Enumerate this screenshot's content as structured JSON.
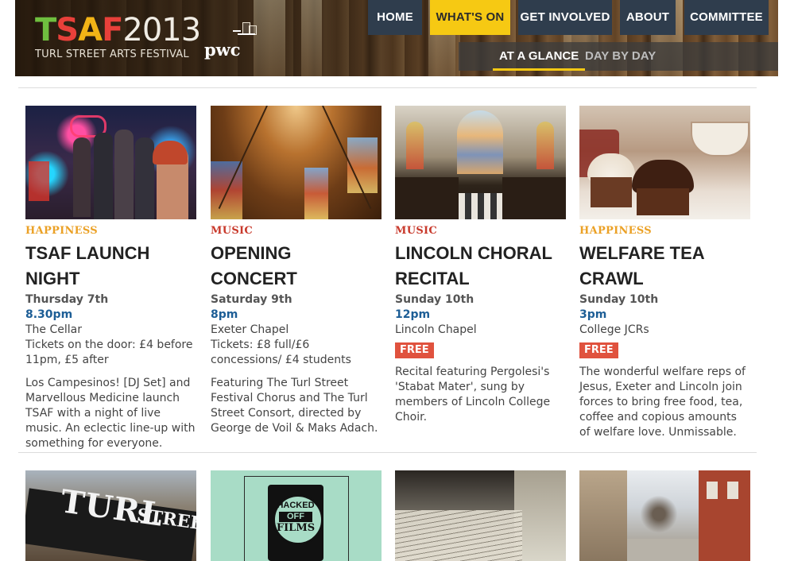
{
  "site": {
    "logo": {
      "letters": [
        "T",
        "S",
        "A",
        "F"
      ],
      "year": "2013"
    },
    "tagline": "TURL STREET ARTS FESTIVAL",
    "sponsor": "pwc"
  },
  "nav": {
    "items": [
      {
        "label": "HOME",
        "active": false
      },
      {
        "label": "WHAT'S ON",
        "active": true
      },
      {
        "label": "GET INVOLVED",
        "active": false
      },
      {
        "label": "ABOUT",
        "active": false
      },
      {
        "label": "COMMITTEE",
        "active": false
      }
    ],
    "subnav": [
      {
        "label": "AT A GLANCE",
        "active": true
      },
      {
        "label": "DAY BY DAY",
        "active": false
      }
    ]
  },
  "events": [
    {
      "category": "HAPPINESS",
      "title": "TSAF LAUNCH NIGHT",
      "date": "Thursday 7th",
      "time": "8.30pm",
      "venue": "The Cellar",
      "price": "Tickets on the door: £4 before 11pm, £5 after",
      "free_badge": "",
      "description": "Los Campesinos! [DJ Set] and Marvellous Medicine launch TSAF with a night of live music. An eclectic line-up with something for everyone."
    },
    {
      "category": "MUSIC",
      "title": "OPENING CONCERT",
      "date": "Saturday 9th",
      "time": "8pm",
      "venue": "Exeter Chapel",
      "price": "Tickets: £8 full/£6 concessions/ £4 students",
      "free_badge": "",
      "description": "Featuring The Turl Street Festival Chorus and The Turl Street Consort, directed by George de Voil & Maks Adach."
    },
    {
      "category": "MUSIC",
      "title": "LINCOLN CHORAL RECITAL",
      "date": "Sunday 10th",
      "time": "12pm",
      "venue": "Lincoln Chapel",
      "price": "",
      "free_badge": "FREE",
      "description": "Recital featuring Pergolesi's 'Stabat Mater', sung by members of Lincoln College Choir."
    },
    {
      "category": "HAPPINESS",
      "title": "WELFARE TEA CRAWL",
      "date": "Sunday 10th",
      "time": "3pm",
      "venue": "College JCRs",
      "price": "",
      "free_badge": "FREE",
      "description": "The wonderful welfare reps of Jesus, Exeter and Lincoln join forces to bring free food, tea, coffee and copious amounts of welfare love. Unmissable."
    }
  ],
  "row2_images": {
    "street_sign": {
      "line1": "TURL",
      "line2": "STREET"
    },
    "film_logo": {
      "line1": "HACKED",
      "line2": "OFF",
      "line3": "FILMS"
    }
  },
  "colors": {
    "nav_bg": "#2f3d4d",
    "nav_active": "#f6c913",
    "happiness": "#eba126",
    "music": "#c8392b",
    "time": "#1d5e96",
    "free_badge": "#e0523e"
  }
}
